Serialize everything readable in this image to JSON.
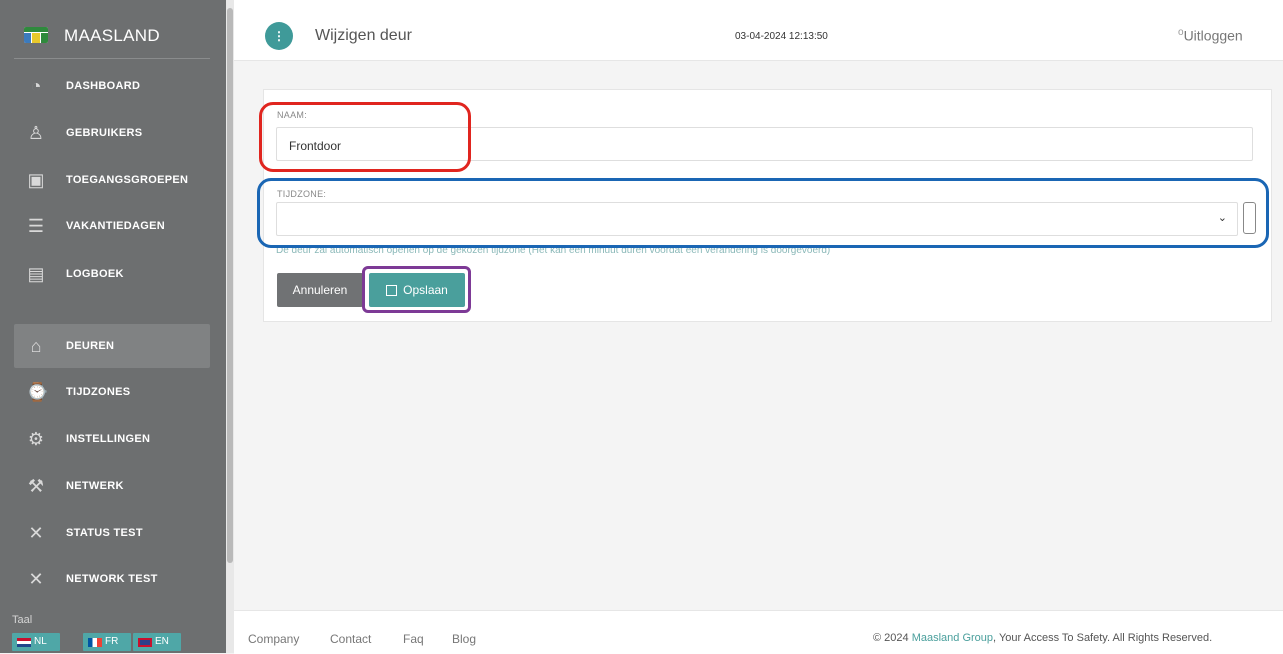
{
  "app": {
    "brand": "MAASLAND"
  },
  "sidebar": {
    "items": [
      {
        "label": "DASHBOARD",
        "icon": "dashboard-icon"
      },
      {
        "label": "GEBRUIKERS",
        "icon": "user-icon"
      },
      {
        "label": "TOEGANGSGROEPEN",
        "icon": "id-card-icon"
      },
      {
        "label": "VAKANTIEDAGEN",
        "icon": "list-icon"
      },
      {
        "label": "LOGBOEK",
        "icon": "clipboard-icon"
      },
      {
        "label": "DEUREN",
        "icon": "lock-icon",
        "active": true
      },
      {
        "label": "TIJDZONES",
        "icon": "watch-icon"
      },
      {
        "label": "INSTELLINGEN",
        "icon": "gear-icon"
      },
      {
        "label": "NETWERK",
        "icon": "wrench-icon"
      },
      {
        "label": "STATUS TEST",
        "icon": "tools-icon"
      },
      {
        "label": "NETWORK TEST",
        "icon": "tools-icon"
      }
    ],
    "language_label": "Taal",
    "languages": [
      "NL",
      "FR",
      "EN"
    ]
  },
  "header": {
    "title": "Wijzigen deur",
    "datetime": "03-04-2024 12:13:50",
    "logout": "Uitloggen"
  },
  "form": {
    "name_label": "NAAM:",
    "name_value": "Frontdoor",
    "timezone_label": "TIJDZONE:",
    "timezone_value": "",
    "help_text": "De deur zal automatisch openen op de gekozen tijdzone (Het kan een minuut duren voordat een verandering is doorgevoerd)",
    "cancel_label": "Annuleren",
    "save_label": "Opslaan"
  },
  "footer": {
    "links": [
      "Company",
      "Contact",
      "Faq",
      "Blog"
    ],
    "copyright_prefix": "© 2024 ",
    "copyright_brand": "Maasland Group",
    "copyright_suffix": ", Your Access To Safety. All Rights Reserved."
  },
  "colors": {
    "accent": "#4a9f9c",
    "sidebar": "#6d6f70",
    "annotation_red": "#e0251f",
    "annotation_blue": "#1a66b4",
    "annotation_purple": "#7d3a96"
  }
}
